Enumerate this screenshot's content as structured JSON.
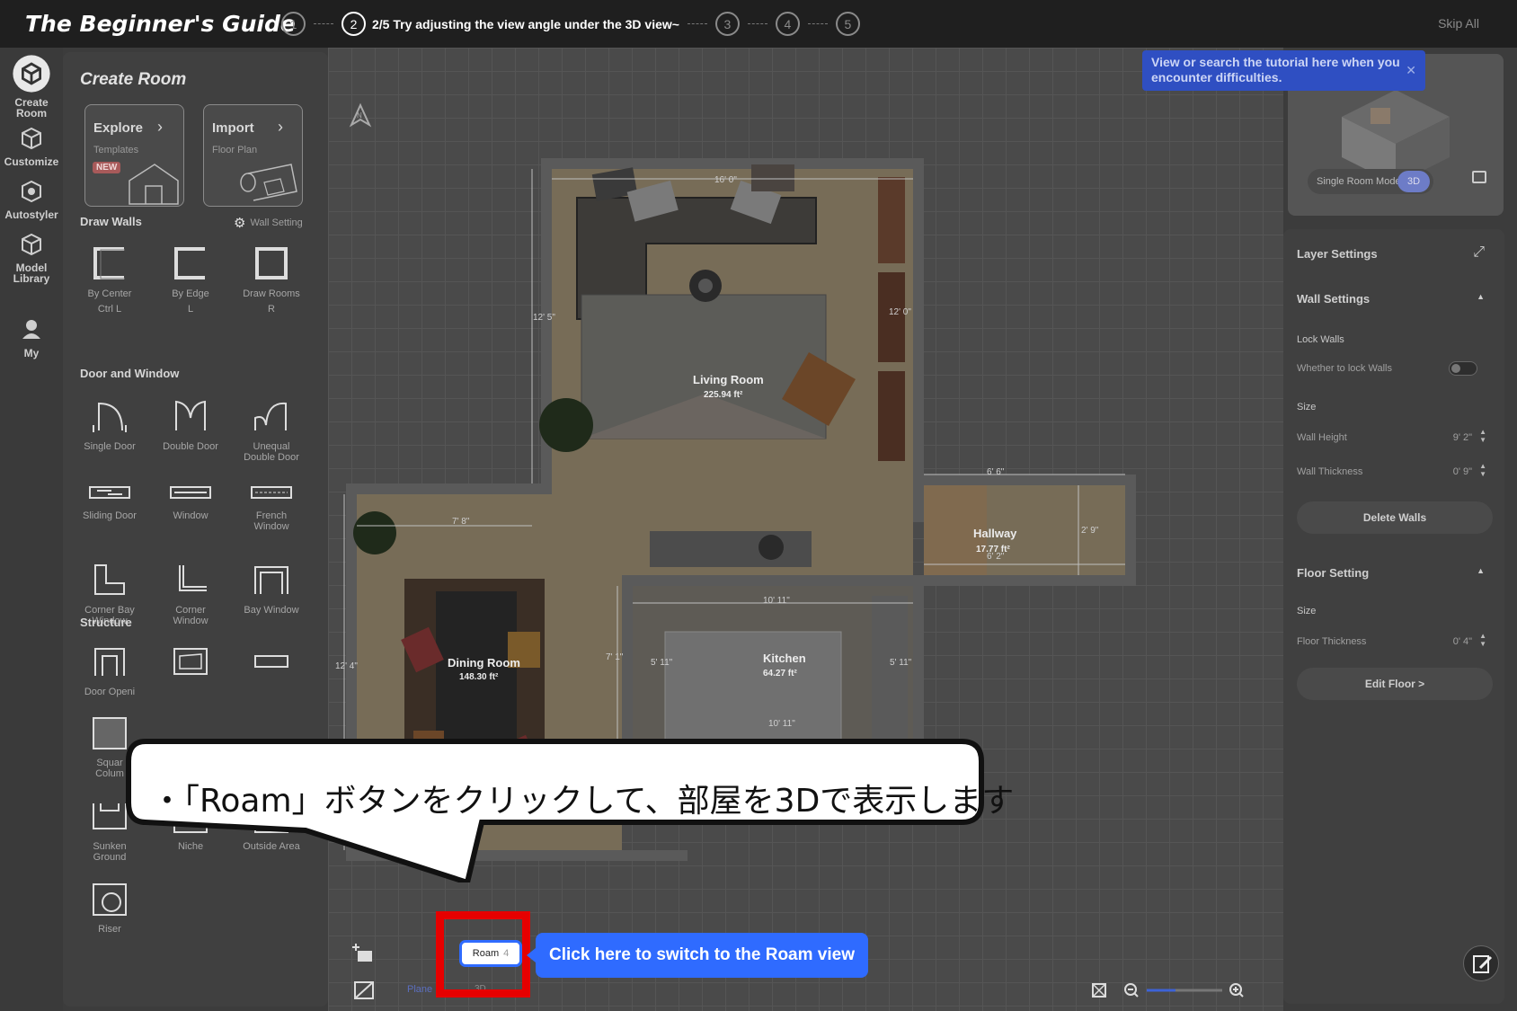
{
  "topbar": {
    "brand": "The Beginner's Guide",
    "steps": [
      "1",
      "2",
      "3",
      "4",
      "5"
    ],
    "current_step_text": "2/5 Try adjusting the view angle under the 3D view~",
    "skip_label": "Skip All"
  },
  "rail": {
    "items": [
      {
        "label_line1": "Create",
        "label_line2": "Room"
      },
      {
        "label_line1": "Customize",
        "label_line2": ""
      },
      {
        "label_line1": "Autostyler",
        "label_line2": ""
      },
      {
        "label_line1": "Model",
        "label_line2": "Library"
      },
      {
        "label_line1": "My",
        "label_line2": ""
      }
    ]
  },
  "panel": {
    "title": "Create Room",
    "cards": [
      {
        "title": "Explore",
        "sub": "Templates",
        "badge": "NEW"
      },
      {
        "title": "Import",
        "sub": "Floor Plan"
      }
    ],
    "draw_walls": {
      "title": "Draw Walls",
      "setting": "Wall Setting",
      "tools": [
        {
          "l1": "By Center",
          "l2": "Ctrl L"
        },
        {
          "l1": "By Edge",
          "l2": "L"
        },
        {
          "l1": "Draw Rooms",
          "l2": "R"
        }
      ]
    },
    "door_window": {
      "title": "Door and Window",
      "tools": [
        {
          "l1": "Single Door",
          "l2": ""
        },
        {
          "l1": "Double Door",
          "l2": ""
        },
        {
          "l1": "Unequal",
          "l2": "Double Door"
        },
        {
          "l1": "Sliding Door",
          "l2": ""
        },
        {
          "l1": "Window",
          "l2": ""
        },
        {
          "l1": "French",
          "l2": "Window"
        },
        {
          "l1": "Corner Bay",
          "l2": "Window"
        },
        {
          "l1": "Corner",
          "l2": "Window"
        },
        {
          "l1": "Bay Window",
          "l2": ""
        }
      ]
    },
    "structure": {
      "title": "Structure",
      "tools": [
        {
          "l1": "Door Openi",
          "l2": ""
        },
        {
          "l1": "Squar",
          "l2": "Colum"
        },
        {
          "l1": "Sunken",
          "l2": "Ground"
        },
        {
          "l1": "Niche",
          "l2": ""
        },
        {
          "l1": "Outside Area",
          "l2": ""
        },
        {
          "l1": "Riser",
          "l2": ""
        }
      ]
    }
  },
  "floorplan": {
    "compass": "N",
    "rooms": [
      {
        "name": "Living Room",
        "area": "225.94 ft²"
      },
      {
        "name": "Hallway",
        "area": "17.77 ft²"
      },
      {
        "name": "Dining Room",
        "area": "148.30 ft²"
      },
      {
        "name": "Kitchen",
        "area": "64.27 ft²"
      }
    ],
    "dimensions": [
      "16' 0\"",
      "12' 5\"",
      "12' 0\"",
      "7' 8\"",
      "6' 6\"",
      "2' 9\"",
      "6' 2\"",
      "10' 11\"",
      "7' 1\"",
      "5' 11\"",
      "5' 11\"",
      "12' 4\"",
      "10' 11\""
    ]
  },
  "preview": {
    "mode_label": "Single Room Mode",
    "view_label": "3D"
  },
  "tooltip_top": "View or search the tutorial here when you encounter difficulties.",
  "right_panel": {
    "layer_settings": "Layer Settings",
    "wall_settings": "Wall Settings",
    "lock_walls": "Lock Walls",
    "lock_walls_desc": "Whether to lock Walls",
    "size": "Size",
    "wall_height_label": "Wall Height",
    "wall_height_value": "9' 2\"",
    "wall_thickness_label": "Wall Thickness",
    "wall_thickness_value": "0' 9\"",
    "delete_walls": "Delete Walls",
    "floor_setting": "Floor Setting",
    "floor_size": "Size",
    "floor_thickness_label": "Floor Thickness",
    "floor_thickness_value": "0' 4\"",
    "edit_floor": "Edit Floor >"
  },
  "bubble_text": "・「Roam」ボタンをクリックして、部屋を3Dで表示します",
  "roam": {
    "label": "Roam",
    "shortcut": "4",
    "callout": "Click here to switch to the Roam view"
  },
  "view_tabs": {
    "plane": "Plane",
    "threed": "3D"
  }
}
